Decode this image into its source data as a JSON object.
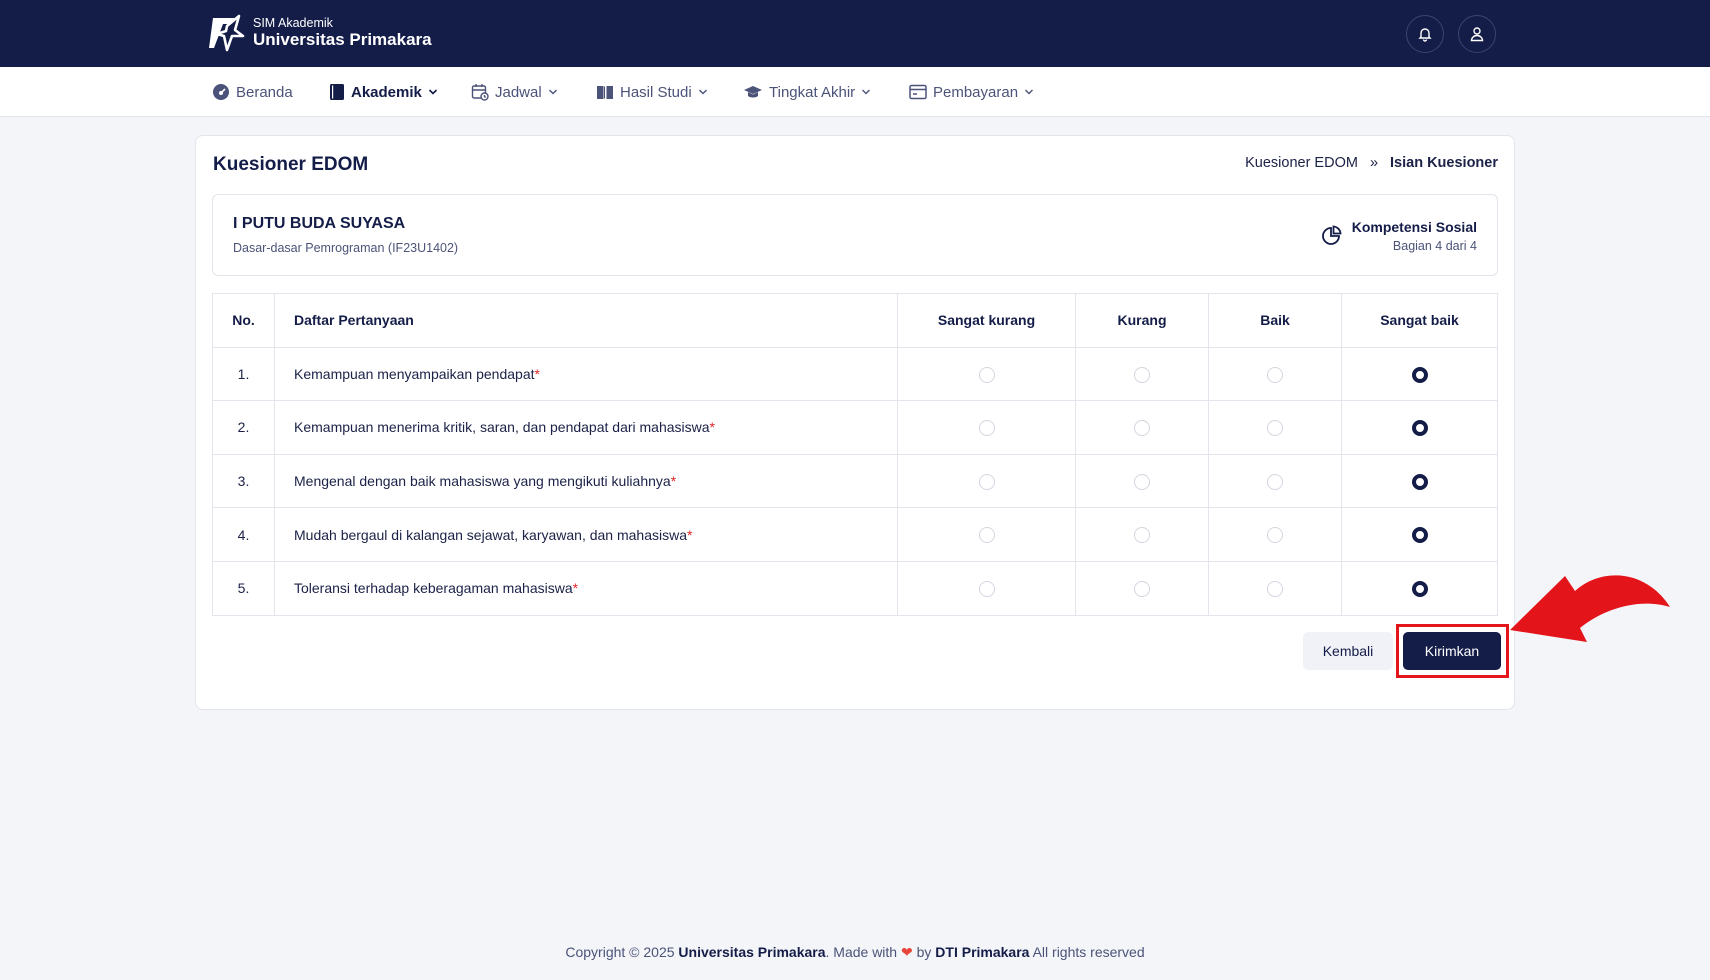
{
  "header": {
    "app_sub": "SIM Akademik",
    "app_name": "Universitas Primakara",
    "notification_icon": "bell-icon",
    "profile_icon": "user-icon"
  },
  "nav": {
    "items": [
      {
        "label": "Beranda",
        "icon": "dashboard-icon",
        "active": false
      },
      {
        "label": "Akademik",
        "icon": "book-icon",
        "active": true
      },
      {
        "label": "Jadwal",
        "icon": "calendar-icon",
        "active": false
      },
      {
        "label": "Hasil Studi",
        "icon": "open-book-icon",
        "active": false
      },
      {
        "label": "Tingkat Akhir",
        "icon": "graduation-cap-icon",
        "active": false
      },
      {
        "label": "Pembayaran",
        "icon": "card-icon",
        "active": false
      }
    ]
  },
  "page": {
    "title": "Kuesioner EDOM",
    "breadcrumb": [
      "Kuesioner EDOM",
      "»",
      "Isian Kuesioner"
    ]
  },
  "info": {
    "lecturer": "I PUTU BUDA SUYASA",
    "course": "Dasar-dasar Pemrograman (IF23U1402)",
    "section_title": "Kompetensi Sosial",
    "section_part": "Bagian 4 dari 4"
  },
  "table": {
    "headers": [
      "No.",
      "Daftar Pertanyaan",
      "Sangat kurang",
      "Kurang",
      "Baik",
      "Sangat baik"
    ],
    "rows": [
      {
        "no": "1.",
        "question": "Kemampuan menyampaikan pendapat",
        "selected": 3
      },
      {
        "no": "2.",
        "question": "Kemampuan menerima kritik, saran, dan pendapat dari mahasiswa",
        "selected": 3
      },
      {
        "no": "3.",
        "question": "Mengenal dengan baik mahasiswa yang mengikuti kuliahnya",
        "selected": 3
      },
      {
        "no": "4.",
        "question": "Mudah bergaul di kalangan sejawat, karyawan, dan mahasiswa",
        "selected": 3
      },
      {
        "no": "5.",
        "question": "Toleransi terhadap keberagaman mahasiswa",
        "selected": 3
      }
    ],
    "required_mark": "*"
  },
  "actions": {
    "back_label": "Kembali",
    "submit_label": "Kirimkan"
  },
  "footer": {
    "prefix": "Copyright © 2025 ",
    "org": "Universitas Primakara",
    "made_with": ". Made with ",
    "heart": "❤",
    "by": " by ",
    "team": "DTI Primakara",
    "suffix": " All rights reserved"
  },
  "colors": {
    "primary": "#141c48",
    "highlight": "#e4141b"
  }
}
